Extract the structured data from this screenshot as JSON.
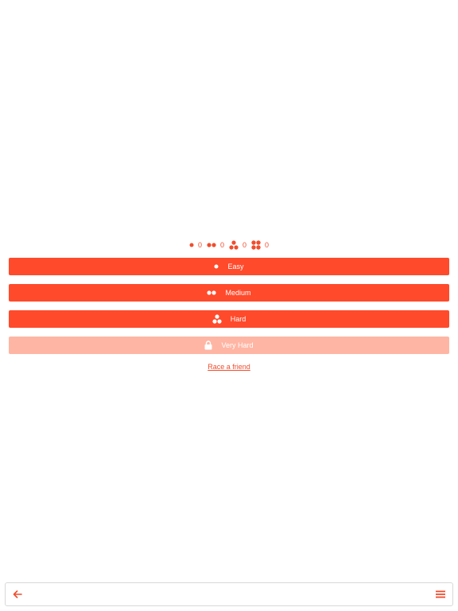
{
  "colors": {
    "accent": "#ff4a2b",
    "accent_text": "#f04d2d",
    "locked": "#ffb5a3",
    "on_accent": "#ffffff",
    "toolbar_border": "#d8d8d8"
  },
  "scores": [
    {
      "icon": "one-dot-icon",
      "count": "0"
    },
    {
      "icon": "two-dots-icon",
      "count": "0"
    },
    {
      "icon": "three-dots-icon",
      "count": "0"
    },
    {
      "icon": "four-dots-icon",
      "count": "0"
    }
  ],
  "levels": {
    "easy": {
      "label": "Easy",
      "icon": "one-dot-icon",
      "locked": false
    },
    "medium": {
      "label": "Medium",
      "icon": "two-dots-icon",
      "locked": false
    },
    "hard": {
      "label": "Hard",
      "icon": "three-dots-icon",
      "locked": false
    },
    "very_hard": {
      "label": "Very Hard",
      "icon": "lock-icon",
      "locked": true
    }
  },
  "race_link": "Race a friend",
  "toolbar": {
    "back_icon": "back-arrow-icon",
    "menu_icon": "hamburger-menu-icon"
  }
}
